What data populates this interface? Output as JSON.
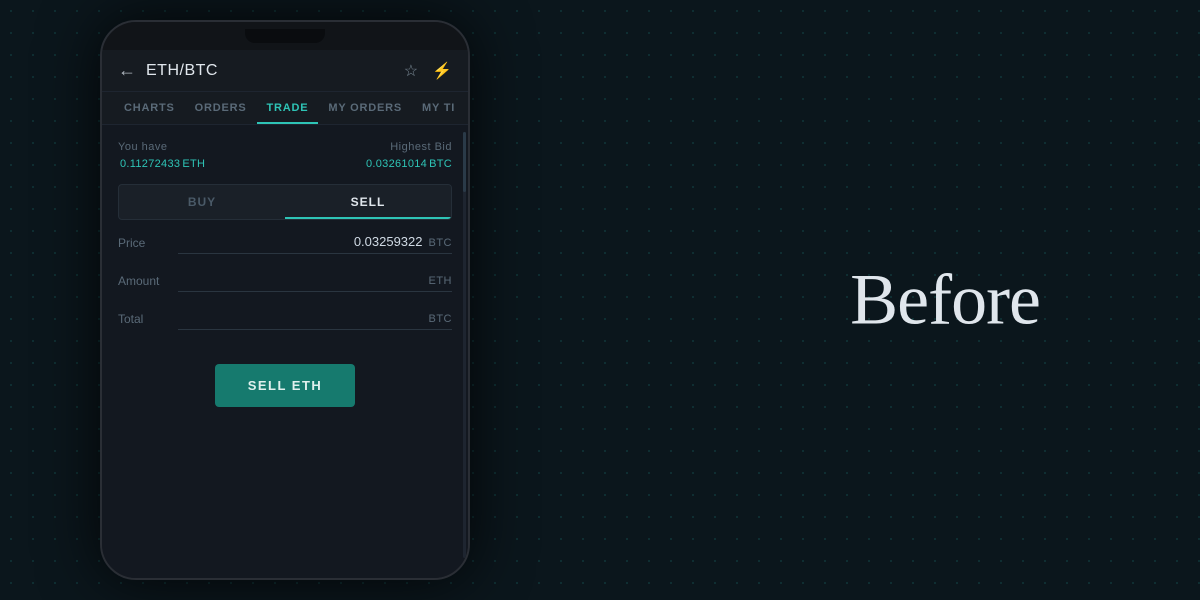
{
  "header": {
    "back_icon": "←",
    "pair_title": "ETH/BTC",
    "star_icon": "☆",
    "lightning_icon": "⚡"
  },
  "nav": {
    "tabs": [
      {
        "label": "CHARTS",
        "active": false
      },
      {
        "label": "ORDERS",
        "active": false
      },
      {
        "label": "TRADE",
        "active": true
      },
      {
        "label": "MY ORDERS",
        "active": false
      },
      {
        "label": "MY TI",
        "active": false
      }
    ]
  },
  "balance": {
    "you_have_label": "You have",
    "you_have_value": "0.11272433",
    "you_have_unit": "ETH",
    "highest_bid_label": "Highest Bid",
    "highest_bid_value": "0.03261014",
    "highest_bid_unit": "BTC"
  },
  "trade_toggle": {
    "buy_label": "BUY",
    "sell_label": "SELL"
  },
  "form": {
    "price_label": "Price",
    "price_value": "0.03259322",
    "price_unit": "BTC",
    "amount_label": "Amount",
    "amount_value": "",
    "amount_unit": "ETH",
    "total_label": "Total",
    "total_value": "",
    "total_unit": "BTC"
  },
  "sell_button": {
    "label": "SELL ETH"
  },
  "before_text": "Before"
}
